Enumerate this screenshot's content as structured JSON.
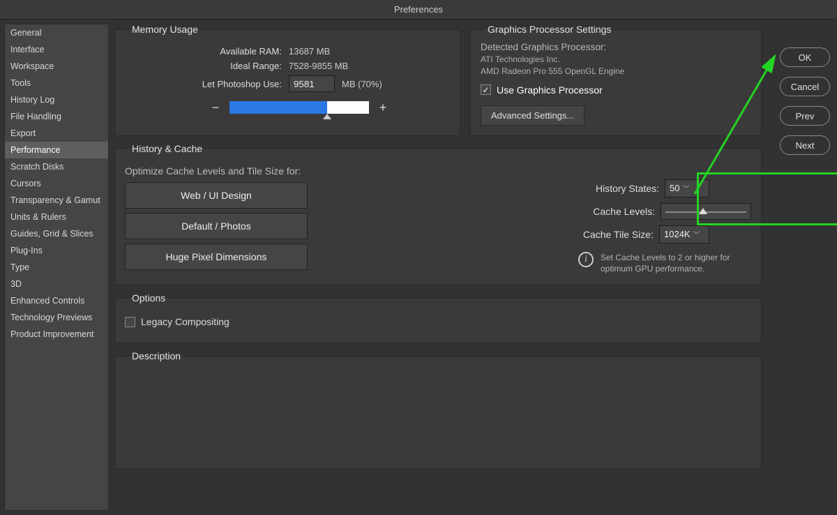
{
  "title": "Preferences",
  "sidebar": {
    "items": [
      "General",
      "Interface",
      "Workspace",
      "Tools",
      "History Log",
      "File Handling",
      "Export",
      "Performance",
      "Scratch Disks",
      "Cursors",
      "Transparency & Gamut",
      "Units & Rulers",
      "Guides, Grid & Slices",
      "Plug-Ins",
      "Type",
      "3D",
      "Enhanced Controls",
      "Technology Previews",
      "Product Improvement"
    ],
    "selected_index": 7
  },
  "buttons": {
    "ok": "OK",
    "cancel": "Cancel",
    "prev": "Prev",
    "next": "Next"
  },
  "memory": {
    "legend": "Memory Usage",
    "available_label": "Available RAM:",
    "available_value": "13687 MB",
    "ideal_label": "Ideal Range:",
    "ideal_value": "7528-9855 MB",
    "let_use_label": "Let Photoshop Use:",
    "let_use_value": "9581",
    "unit_percent": "MB (70%)",
    "minus": "−",
    "plus": "+"
  },
  "gpu": {
    "legend": "Graphics Processor Settings",
    "detected_label": "Detected Graphics Processor:",
    "vendor": "ATI Technologies Inc.",
    "model": "AMD Radeon Pro 555 OpenGL Engine",
    "use_gpu_label": "Use Graphics Processor",
    "use_gpu_checked": true,
    "advanced": "Advanced Settings..."
  },
  "history": {
    "legend": "History & Cache",
    "optimize_label": "Optimize Cache Levels and Tile Size for:",
    "btn_web": "Web / UI Design",
    "btn_default": "Default / Photos",
    "btn_huge": "Huge Pixel Dimensions",
    "history_states_label": "History States:",
    "history_states_value": "50",
    "cache_levels_label": "Cache Levels:",
    "cache_tile_label": "Cache Tile Size:",
    "cache_tile_value": "1024K",
    "info_text": "Set Cache Levels to 2 or higher for optimum GPU performance."
  },
  "options": {
    "legend": "Options",
    "legacy_label": "Legacy Compositing",
    "legacy_checked": false
  },
  "description": {
    "legend": "Description"
  }
}
